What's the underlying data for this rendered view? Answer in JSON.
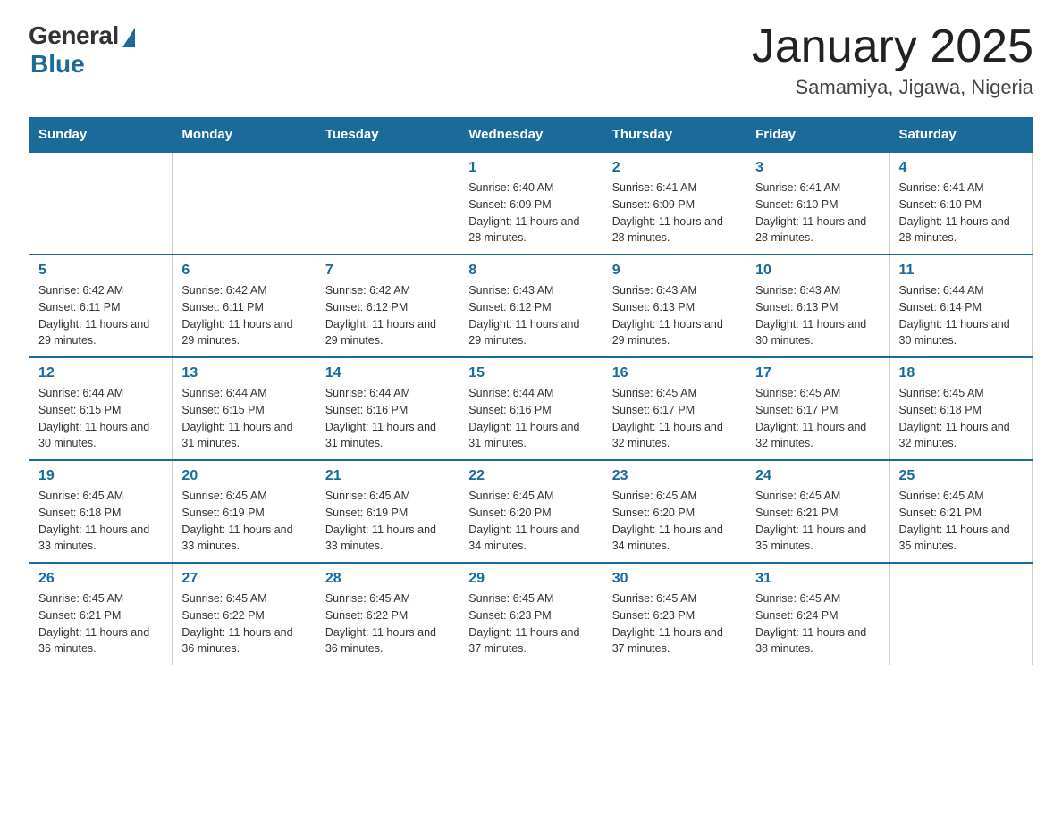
{
  "logo": {
    "general": "General",
    "blue": "Blue"
  },
  "title": "January 2025",
  "location": "Samamiya, Jigawa, Nigeria",
  "headers": [
    "Sunday",
    "Monday",
    "Tuesday",
    "Wednesday",
    "Thursday",
    "Friday",
    "Saturday"
  ],
  "weeks": [
    [
      {
        "day": "",
        "info": ""
      },
      {
        "day": "",
        "info": ""
      },
      {
        "day": "",
        "info": ""
      },
      {
        "day": "1",
        "info": "Sunrise: 6:40 AM\nSunset: 6:09 PM\nDaylight: 11 hours and 28 minutes."
      },
      {
        "day": "2",
        "info": "Sunrise: 6:41 AM\nSunset: 6:09 PM\nDaylight: 11 hours and 28 minutes."
      },
      {
        "day": "3",
        "info": "Sunrise: 6:41 AM\nSunset: 6:10 PM\nDaylight: 11 hours and 28 minutes."
      },
      {
        "day": "4",
        "info": "Sunrise: 6:41 AM\nSunset: 6:10 PM\nDaylight: 11 hours and 28 minutes."
      }
    ],
    [
      {
        "day": "5",
        "info": "Sunrise: 6:42 AM\nSunset: 6:11 PM\nDaylight: 11 hours and 29 minutes."
      },
      {
        "day": "6",
        "info": "Sunrise: 6:42 AM\nSunset: 6:11 PM\nDaylight: 11 hours and 29 minutes."
      },
      {
        "day": "7",
        "info": "Sunrise: 6:42 AM\nSunset: 6:12 PM\nDaylight: 11 hours and 29 minutes."
      },
      {
        "day": "8",
        "info": "Sunrise: 6:43 AM\nSunset: 6:12 PM\nDaylight: 11 hours and 29 minutes."
      },
      {
        "day": "9",
        "info": "Sunrise: 6:43 AM\nSunset: 6:13 PM\nDaylight: 11 hours and 29 minutes."
      },
      {
        "day": "10",
        "info": "Sunrise: 6:43 AM\nSunset: 6:13 PM\nDaylight: 11 hours and 30 minutes."
      },
      {
        "day": "11",
        "info": "Sunrise: 6:44 AM\nSunset: 6:14 PM\nDaylight: 11 hours and 30 minutes."
      }
    ],
    [
      {
        "day": "12",
        "info": "Sunrise: 6:44 AM\nSunset: 6:15 PM\nDaylight: 11 hours and 30 minutes."
      },
      {
        "day": "13",
        "info": "Sunrise: 6:44 AM\nSunset: 6:15 PM\nDaylight: 11 hours and 31 minutes."
      },
      {
        "day": "14",
        "info": "Sunrise: 6:44 AM\nSunset: 6:16 PM\nDaylight: 11 hours and 31 minutes."
      },
      {
        "day": "15",
        "info": "Sunrise: 6:44 AM\nSunset: 6:16 PM\nDaylight: 11 hours and 31 minutes."
      },
      {
        "day": "16",
        "info": "Sunrise: 6:45 AM\nSunset: 6:17 PM\nDaylight: 11 hours and 32 minutes."
      },
      {
        "day": "17",
        "info": "Sunrise: 6:45 AM\nSunset: 6:17 PM\nDaylight: 11 hours and 32 minutes."
      },
      {
        "day": "18",
        "info": "Sunrise: 6:45 AM\nSunset: 6:18 PM\nDaylight: 11 hours and 32 minutes."
      }
    ],
    [
      {
        "day": "19",
        "info": "Sunrise: 6:45 AM\nSunset: 6:18 PM\nDaylight: 11 hours and 33 minutes."
      },
      {
        "day": "20",
        "info": "Sunrise: 6:45 AM\nSunset: 6:19 PM\nDaylight: 11 hours and 33 minutes."
      },
      {
        "day": "21",
        "info": "Sunrise: 6:45 AM\nSunset: 6:19 PM\nDaylight: 11 hours and 33 minutes."
      },
      {
        "day": "22",
        "info": "Sunrise: 6:45 AM\nSunset: 6:20 PM\nDaylight: 11 hours and 34 minutes."
      },
      {
        "day": "23",
        "info": "Sunrise: 6:45 AM\nSunset: 6:20 PM\nDaylight: 11 hours and 34 minutes."
      },
      {
        "day": "24",
        "info": "Sunrise: 6:45 AM\nSunset: 6:21 PM\nDaylight: 11 hours and 35 minutes."
      },
      {
        "day": "25",
        "info": "Sunrise: 6:45 AM\nSunset: 6:21 PM\nDaylight: 11 hours and 35 minutes."
      }
    ],
    [
      {
        "day": "26",
        "info": "Sunrise: 6:45 AM\nSunset: 6:21 PM\nDaylight: 11 hours and 36 minutes."
      },
      {
        "day": "27",
        "info": "Sunrise: 6:45 AM\nSunset: 6:22 PM\nDaylight: 11 hours and 36 minutes."
      },
      {
        "day": "28",
        "info": "Sunrise: 6:45 AM\nSunset: 6:22 PM\nDaylight: 11 hours and 36 minutes."
      },
      {
        "day": "29",
        "info": "Sunrise: 6:45 AM\nSunset: 6:23 PM\nDaylight: 11 hours and 37 minutes."
      },
      {
        "day": "30",
        "info": "Sunrise: 6:45 AM\nSunset: 6:23 PM\nDaylight: 11 hours and 37 minutes."
      },
      {
        "day": "31",
        "info": "Sunrise: 6:45 AM\nSunset: 6:24 PM\nDaylight: 11 hours and 38 minutes."
      },
      {
        "day": "",
        "info": ""
      }
    ]
  ]
}
